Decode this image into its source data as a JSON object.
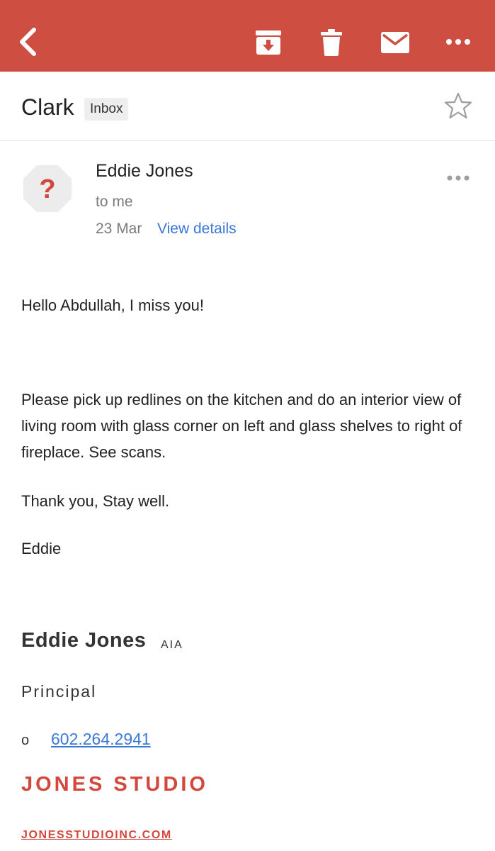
{
  "toolbar": {
    "back_icon": "back-arrow-icon",
    "archive_icon": "archive-icon",
    "delete_icon": "trash-icon",
    "mark_unread_icon": "mail-icon",
    "more_icon": "more-horizontal-icon",
    "bar_color": "#cf4e42"
  },
  "subject_row": {
    "subject": "Clark",
    "label": "Inbox",
    "star_icon": "star-outline-icon"
  },
  "message_header": {
    "avatar_icon": "unknown-sender-icon",
    "sender": "Eddie Jones",
    "recipient": "to me",
    "date": "23 Mar",
    "view_details": "View details",
    "more_icon": "more-horizontal-icon"
  },
  "message_body": {
    "greeting": "Hello Abdullah, I miss you!",
    "paragraph": "Please pick up redlines on the kitchen and do an interior view of living room with glass corner on left and glass shelves to right of fireplace. See scans.",
    "closing": "Thank you, Stay well.",
    "signoff": "Eddie"
  },
  "signature": {
    "name": "Eddie Jones",
    "credential": "AIA",
    "title": "Principal",
    "phone_label": "o",
    "phone": "602.264.2941",
    "company": "JONES STUDIO",
    "website": "JONESSTUDIOINC.COM",
    "brand_color": "#d4473c"
  },
  "colors": {
    "link": "#3a78d8",
    "secondary_text": "#7a7a7a"
  }
}
